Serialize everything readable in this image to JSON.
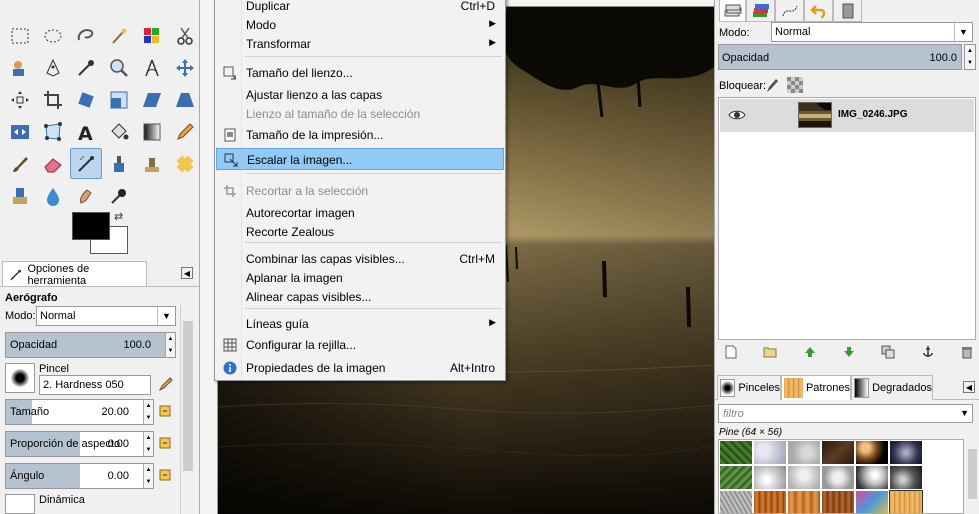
{
  "image_menu": {
    "items": [
      {
        "label": "Duplicar",
        "accel": "Ctrl+D"
      },
      {
        "label": "Modo",
        "submenu": "▶"
      },
      {
        "label": "Transformar",
        "submenu": "▶"
      },
      {
        "label": "Tamaño del lienzo...",
        "icon": "canvas-size-icon"
      },
      {
        "label": "Ajustar lienzo a las capas"
      },
      {
        "label": "Lienzo al tamaño de la selección"
      },
      {
        "label": "Tamaño de la impresión...",
        "icon": "print-size-icon"
      },
      {
        "label": "Escalar la imagen...",
        "icon": "scale-image-icon"
      },
      {
        "label": "Recortar a la selección",
        "icon": "crop-icon"
      },
      {
        "label": "Autorecortar imagen"
      },
      {
        "label": "Recorte Zealous"
      },
      {
        "label": "Combinar las capas visibles...",
        "accel": "Ctrl+M"
      },
      {
        "label": "Aplanar la imagen"
      },
      {
        "label": "Alinear capas visibles..."
      },
      {
        "label": "Líneas guía",
        "submenu": "▶"
      },
      {
        "label": "Configurar la rejilla...",
        "icon": "grid-icon"
      },
      {
        "label": "Propiedades de la imagen",
        "accel": "Alt+Intro",
        "icon": "info-icon"
      }
    ]
  },
  "tool_options": {
    "tab_label": "Opciones de herramienta",
    "title": "Aerógrafo",
    "mode_label": "Modo:",
    "mode_value": "Normal",
    "opacity": {
      "label": "Opacidad",
      "value": "100.0",
      "fraction": 1.0
    },
    "brush_label": "Pincel",
    "brush_value": "2. Hardness 050",
    "size": {
      "label": "Tamaño",
      "value": "20.00",
      "fraction": 0.18
    },
    "aspect": {
      "label": "Proporción de aspecto",
      "value": "0.00",
      "fraction": 0.5
    },
    "angle": {
      "label": "Ángulo",
      "value": "0.00",
      "fraction": 0.5
    },
    "dynamics_label": "Dinámica"
  },
  "layers_panel": {
    "mode_label": "Modo:",
    "mode_value": "Normal",
    "opacity_label": "Opacidad",
    "opacity_value": "100.0",
    "lock_label": "Bloquear:",
    "layer_name": "IMG_0246.JPG"
  },
  "resources": {
    "tab_brushes": "Pinceles",
    "tab_patterns": "Patrones",
    "tab_gradients": "Degradados",
    "filter_placeholder": "filtro",
    "pattern_name": "Pine (64 × 56)"
  },
  "colors": {
    "menu_highlight": "#91c9f7",
    "slider_fill": "#b5c3d1",
    "foreground": "#000000",
    "background": "#ffffff"
  }
}
